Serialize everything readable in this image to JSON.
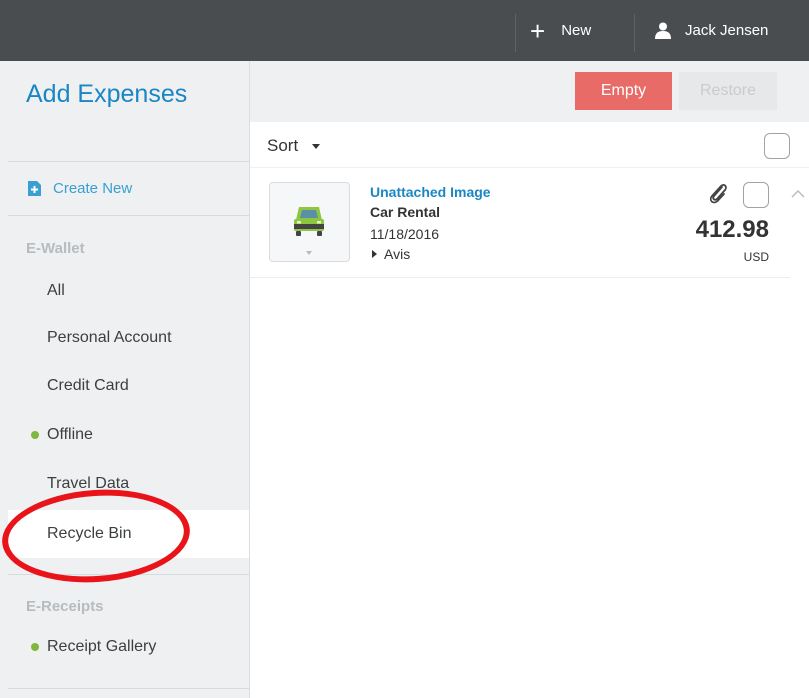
{
  "topbar": {
    "new_label": "New",
    "user_name": "Jack Jensen"
  },
  "sidebar": {
    "title": "Add Expenses",
    "create_new": "Create New",
    "ewallet_heading": "E-Wallet",
    "items": [
      {
        "label": "All"
      },
      {
        "label": "Personal Account"
      },
      {
        "label": "Credit Card"
      },
      {
        "label": "Offline",
        "status": "online-green"
      },
      {
        "label": "Travel Data"
      },
      {
        "label": "Recycle Bin",
        "active": true
      }
    ],
    "ereceipts_heading": "E-Receipts",
    "receipt_gallery": "Receipt Gallery"
  },
  "actions": {
    "empty_label": "Empty",
    "restore_label": "Restore"
  },
  "sort": {
    "label": "Sort"
  },
  "expenses": [
    {
      "link": "Unattached Image",
      "type": "Car Rental",
      "date": "11/18/2016",
      "vendor": "Avis",
      "amount": "412.98",
      "currency": "USD",
      "icon": "car-icon"
    }
  ],
  "colors": {
    "topbar": "#4a4d4f",
    "accent_blue": "#1a87c4",
    "empty_button": "#e86b67",
    "status_dot": "#7fb83e",
    "annotation_red": "#e8141a"
  }
}
